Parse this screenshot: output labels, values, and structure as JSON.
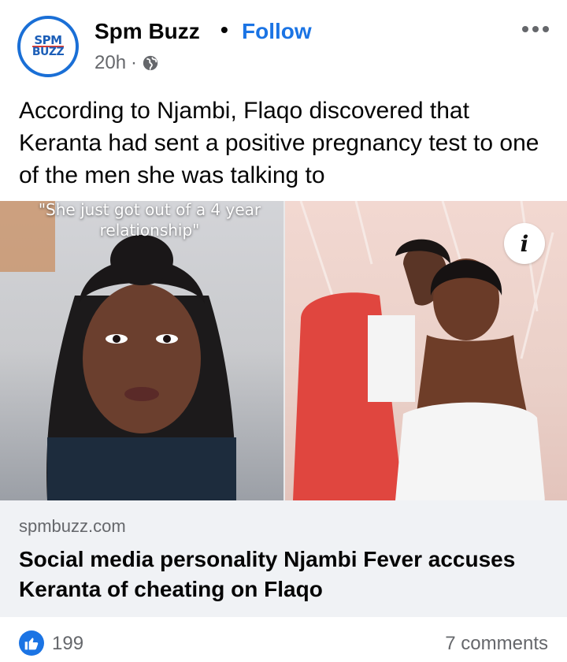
{
  "post": {
    "page_name": "Spm Buzz",
    "separator": "•",
    "follow_label": "Follow",
    "time": "20h",
    "meta_separator": "·",
    "audience_icon": "globe-icon",
    "avatar": {
      "line1": "SPM",
      "line2": "BUZZ"
    },
    "text": "According to Njambi, Flaqo discovered that Keranta had sent a positive pregnancy test to one of the men she was talking to",
    "image_caption": "\"She just got out of a 4 year relationship\"",
    "info_icon_label": "i"
  },
  "link_preview": {
    "domain": "spmbuzz.com",
    "headline": "Social media personality Njambi Fever accuses Keranta of cheating on Flaqo"
  },
  "engagement": {
    "like_count": "199",
    "comments_label": "7 comments"
  },
  "colors": {
    "accent": "#1b74e4",
    "secondary_text": "#65676b",
    "link_box_bg": "#f0f2f5"
  }
}
